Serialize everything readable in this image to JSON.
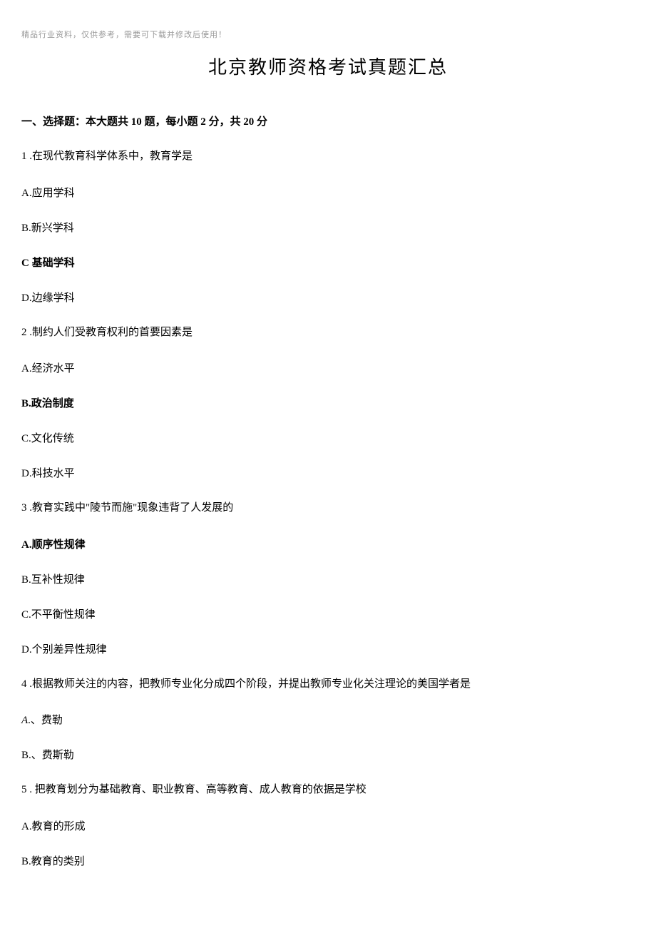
{
  "header_note": "精品行业资料，仅供参考，需要可下载并修改后使用！",
  "title": "北京教师资格考试真题汇总",
  "section_heading": "一、选择题：本大题共 10 题，每小题 2 分，共 20 分",
  "q1": {
    "text": "1 .在现代教育科学体系中，教育学是",
    "a": "A.应用学科",
    "b": "B.新兴学科",
    "c": "C 基础学科",
    "d": "D.边缘学科"
  },
  "q2": {
    "text": "2 .制约人们受教育权利的首要因素是",
    "a": "A.经济水平",
    "b": "B.政治制度",
    "c": "C.文化传统",
    "d": "D.科技水平"
  },
  "q3": {
    "text": "3 .教育实践中\"陵节而施\"现象违背了人发展的",
    "a": "A.顺序性规律",
    "b": "B.互补性规律",
    "c": "C.不平衡性规律",
    "d": "D.个别差异性规律"
  },
  "q4": {
    "text": "4 .根据教师关注的内容，把教师专业化分成四个阶段，并提出教师专业化关注理论的美国学者是",
    "a_prefix": "A",
    "a_suffix": ".、费勒",
    "b": "B.、费斯勒"
  },
  "q5": {
    "text": "5 . 把教育划分为基础教育、职业教育、高等教育、成人教育的依据是学校",
    "a": "A.教育的形成",
    "b": "B.教育的类别"
  }
}
